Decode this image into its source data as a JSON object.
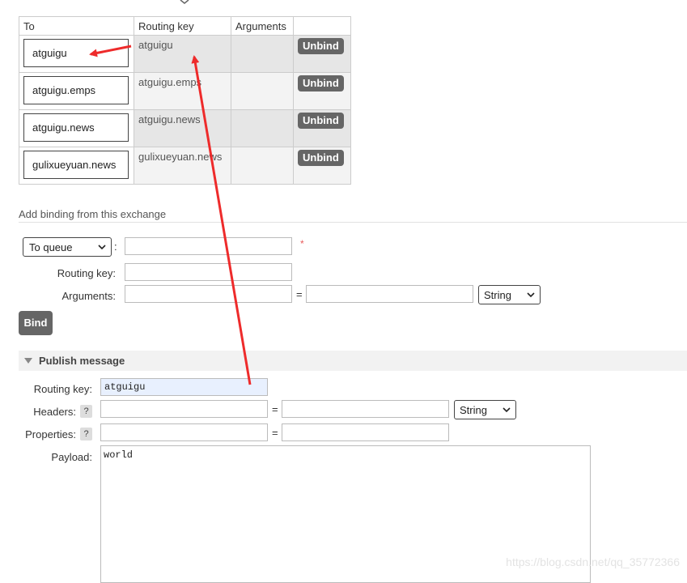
{
  "bindings_table": {
    "headers": [
      "To",
      "Routing key",
      "Arguments",
      ""
    ],
    "rows": [
      {
        "to": "atguigu",
        "routing_key": "atguigu",
        "arguments": "",
        "action": "Unbind"
      },
      {
        "to": "atguigu.emps",
        "routing_key": "atguigu.emps",
        "arguments": "",
        "action": "Unbind"
      },
      {
        "to": "atguigu.news",
        "routing_key": "atguigu.news",
        "arguments": "",
        "action": "Unbind"
      },
      {
        "to": "gulixueyuan.news",
        "routing_key": "gulixueyuan.news",
        "arguments": "",
        "action": "Unbind"
      }
    ]
  },
  "add_binding": {
    "section_label": "Add binding from this exchange",
    "destination_type": "To queue",
    "destination_colon": ":",
    "required_mark": "*",
    "routing_key_label": "Routing key:",
    "arguments_label": "Arguments:",
    "equals": "=",
    "arg_type": "String",
    "bind_button": "Bind"
  },
  "publish": {
    "title": "Publish message",
    "routing_key_label": "Routing key:",
    "routing_key_value": "atguigu",
    "headers_label": "Headers:",
    "properties_label": "Properties:",
    "help_mark": "?",
    "equals": "=",
    "header_type": "String",
    "payload_label": "Payload:",
    "payload_value": "world"
  },
  "watermark": "https://blog.csdn.net/qq_35772366",
  "colors": {
    "button": "#666666",
    "annotation_arrow": "#ee2b2b",
    "routing_key_bg": "#e8f0fe"
  }
}
